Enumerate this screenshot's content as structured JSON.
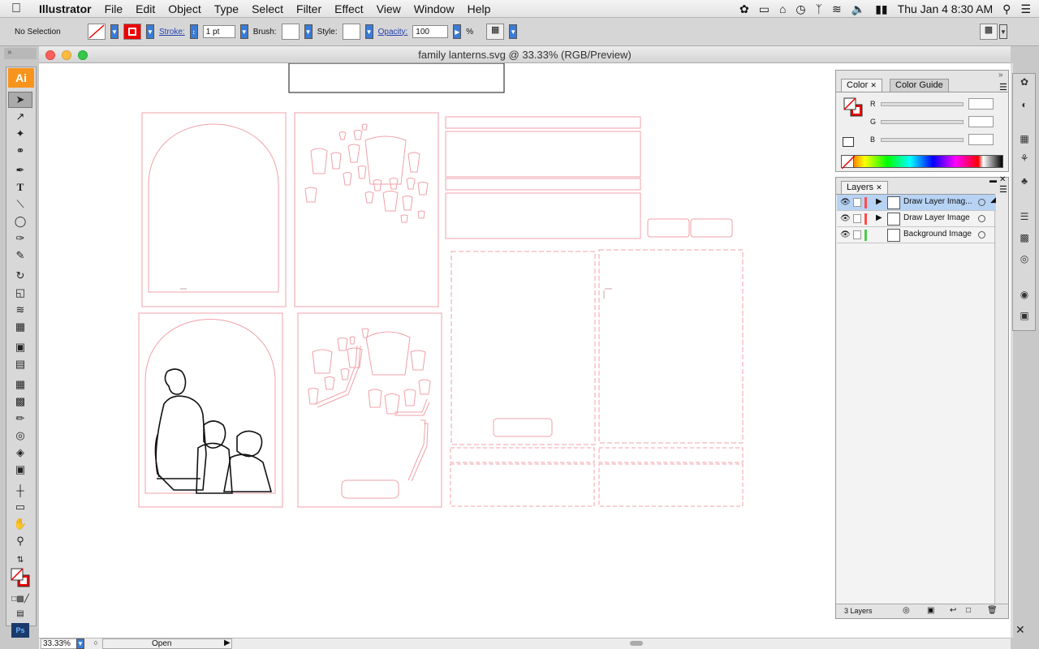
{
  "menubar": {
    "apple_icon": "apple-logo",
    "app_name": "Illustrator",
    "items": [
      "File",
      "Edit",
      "Object",
      "Type",
      "Select",
      "Filter",
      "Effect",
      "View",
      "Window",
      "Help"
    ],
    "clock": "Thu Jan 4  8:30 AM"
  },
  "control": {
    "selection": "No Selection",
    "stroke_label": "Stroke:",
    "stroke_value": "1 pt",
    "brush_label": "Brush:",
    "style_label": "Style:",
    "opacity_label": "Opacity:",
    "opacity_value": "100",
    "percent": "%"
  },
  "toolbar": {
    "logo": "Ai"
  },
  "document": {
    "title": "family lanterns.svg @ 33.33% (RGB/Preview)",
    "zoom": "33.33%",
    "status": "Open"
  },
  "color_panel": {
    "tabs": [
      "Color",
      "Color Guide"
    ],
    "channels": [
      "R",
      "G",
      "B"
    ]
  },
  "layers_panel": {
    "tab": "Layers",
    "layers": [
      {
        "name": "Draw Layer Imag...",
        "color": "#ff4d4d",
        "selected": true
      },
      {
        "name": "Draw Layer Image",
        "color": "#ff4d4d",
        "selected": false
      },
      {
        "name": "Background Image",
        "color": "#4ccc4c",
        "selected": false
      }
    ],
    "count": "3 Layers"
  },
  "colors": {
    "cutline": "#f0a0a8",
    "accent": "#f7941d"
  }
}
